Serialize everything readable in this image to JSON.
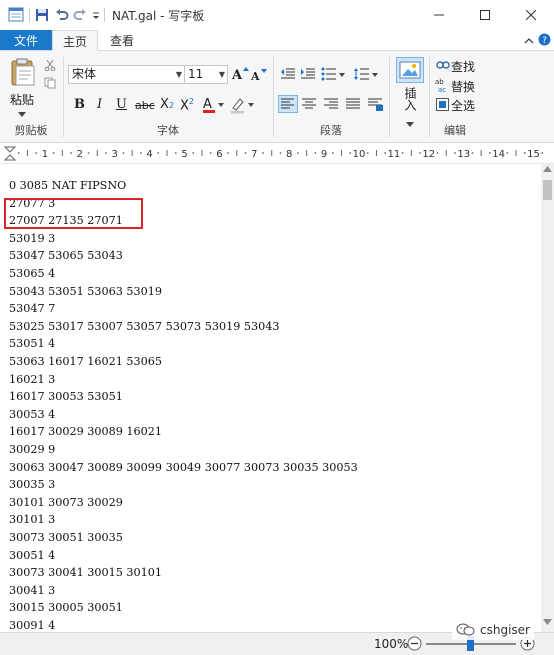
{
  "window": {
    "title": "NAT.gal - 写字板"
  },
  "tabs": [
    {
      "label": "文件"
    },
    {
      "label": "主页"
    },
    {
      "label": "查看"
    }
  ],
  "ribbon": {
    "clipboard": {
      "paste_label": "粘贴",
      "group_label": "剪贴板"
    },
    "font": {
      "font_name": "宋体",
      "font_size": "11",
      "group_label": "字体"
    },
    "paragraph": {
      "group_label": "段落"
    },
    "insert": {
      "label": "插入"
    },
    "editing": {
      "find_label": "查找",
      "replace_label": "替换",
      "select_all_label": "全选",
      "group_label": "编辑"
    }
  },
  "ruler": {
    "numbers": [
      "1",
      "2",
      "3",
      "4",
      "5",
      "6",
      "7",
      "8",
      "9",
      "10",
      "11",
      "12",
      "13",
      "14",
      "15"
    ]
  },
  "document": {
    "lines": [
      "0 3085 NAT FIPSNO",
      "27077 3",
      "27007 27135 27071",
      "53019 3",
      "53047 53065 53043",
      "53065 4",
      "53043 53051 53063 53019",
      "53047 7",
      "53025 53017 53007 53057 53073 53019 53043",
      "53051 4",
      "53063 16017 16021 53065",
      "16021 3",
      "16017 30053 53051",
      "30053 4",
      "16017 30029 30089 16021",
      "30029 9",
      "30063 30047 30089 30099 30049 30077 30073 30035 30053",
      "30035 3",
      "30101 30073 30029",
      "30101 3",
      "30073 30051 30035",
      "30051 4",
      "30073 30041 30015 30101",
      "30041 3",
      "30015 30005 30051",
      "30091 4"
    ],
    "highlight_color": "#d9252a"
  },
  "status": {
    "zoom": "100%"
  },
  "watermark": {
    "text": "cshgiser"
  },
  "colors": {
    "accent": "#1979ca"
  }
}
